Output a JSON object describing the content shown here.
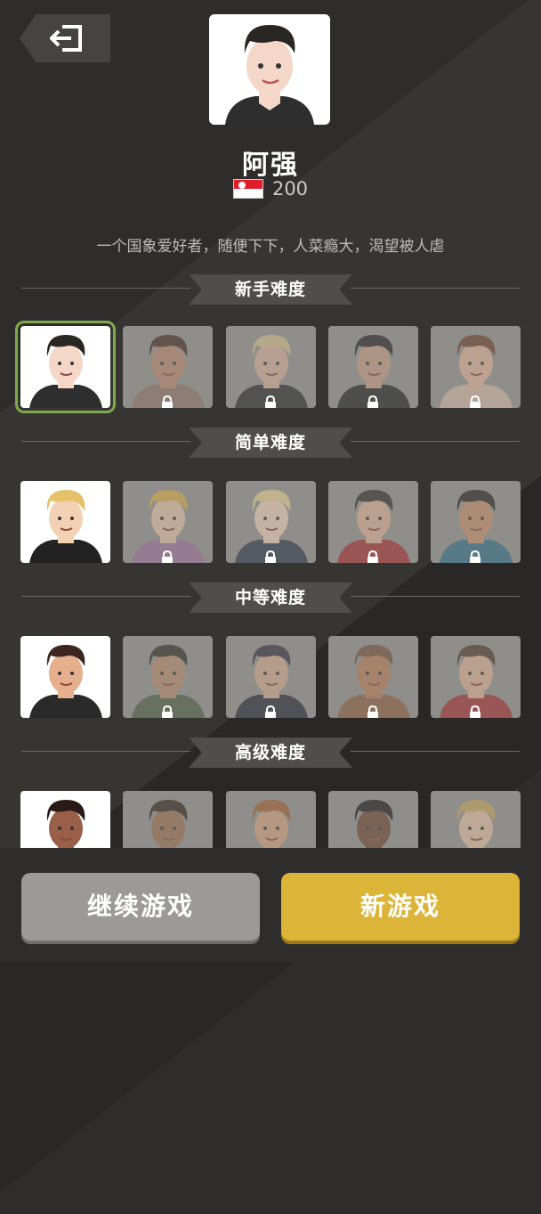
{
  "player": {
    "name": "阿强",
    "rating": "200",
    "bio": "一个国象爱好者，随便下下，人菜瘾大，渴望被人虐",
    "flag": "singapore-flag"
  },
  "sections": [
    {
      "title": "新手难度"
    },
    {
      "title": "简单难度"
    },
    {
      "title": "中等难度"
    },
    {
      "title": "高级难度"
    }
  ],
  "buttons": {
    "continue": "继续游戏",
    "new_game": "新游戏"
  },
  "colors": {
    "background": "#2e2d2b",
    "selected_border": "#7eaa4b",
    "new_game": "#dcb437",
    "continue": "#9b9a98"
  },
  "opponents": [
    [
      {
        "skin": "#f4d7c8",
        "hair": "#2a2624",
        "shirt": "#2e2e2e",
        "locked": false,
        "selected": true
      },
      {
        "skin": "#b98468",
        "hair": "#3e251a",
        "shirt": "#8c6f64",
        "locked": true,
        "selected": false
      },
      {
        "skin": "#d9b098",
        "hair": "#d6c08a",
        "shirt": "#222",
        "locked": true,
        "selected": false
      },
      {
        "skin": "#c79a82",
        "hair": "#1e1c1c",
        "shirt": "#1b1b1b",
        "locked": true,
        "selected": false
      },
      {
        "skin": "#e3b397",
        "hair": "#6a3a23",
        "shirt": "#d5b9a6",
        "locked": true,
        "selected": false
      }
    ],
    [
      {
        "skin": "#f3d1b5",
        "hair": "#e5c26a",
        "shirt": "#222",
        "locked": false,
        "selected": false
      },
      {
        "skin": "#e8c3a8",
        "hair": "#d9ad44",
        "shirt": "#9c6e9b",
        "locked": true,
        "selected": false
      },
      {
        "skin": "#f0cfb7",
        "hair": "#ead28f",
        "shirt": "#273244",
        "locked": true,
        "selected": false
      },
      {
        "skin": "#e2b094",
        "hair": "#2a2523",
        "shirt": "#a42829",
        "locked": true,
        "selected": false
      },
      {
        "skin": "#c68c65",
        "hair": "#1f1a18",
        "shirt": "#2d6b86",
        "locked": true,
        "selected": false
      }
    ],
    [
      {
        "skin": "#e6b08f",
        "hair": "#3b2720",
        "shirt": "#2a2a2a",
        "locked": false,
        "selected": false
      },
      {
        "skin": "#b98966",
        "hair": "#2b241d",
        "shirt": "#4a5a3e",
        "locked": true,
        "selected": false
      },
      {
        "skin": "#d8a88a",
        "hair": "#2a2a3a",
        "shirt": "#1e2230",
        "locked": true,
        "selected": false
      },
      {
        "skin": "#b87b52",
        "hair": "#6f4d33",
        "shirt": "#8a5a3c",
        "locked": true,
        "selected": false
      },
      {
        "skin": "#e0b191",
        "hair": "#4a3224",
        "shirt": "#a3282d",
        "locked": true,
        "selected": false
      }
    ],
    [
      {
        "skin": "#9a5f48",
        "hair": "#2a1a15",
        "shirt": "#2e2e2e",
        "locked": false,
        "selected": false
      },
      {
        "skin": "#9c6b4b",
        "hair": "#2a1e16",
        "shirt": "#2c2c2c",
        "locked": true,
        "selected": false
      },
      {
        "skin": "#d89e7b",
        "hair": "#a25a2c",
        "shirt": "#2b5b3e",
        "locked": true,
        "selected": false
      },
      {
        "skin": "#6a3e2b",
        "hair": "#151111",
        "shirt": "#2c2c2c",
        "locked": true,
        "selected": false
      },
      {
        "skin": "#e3c0a0",
        "hair": "#c7a55a",
        "shirt": "#3c4b5e",
        "locked": true,
        "selected": false
      }
    ]
  ]
}
